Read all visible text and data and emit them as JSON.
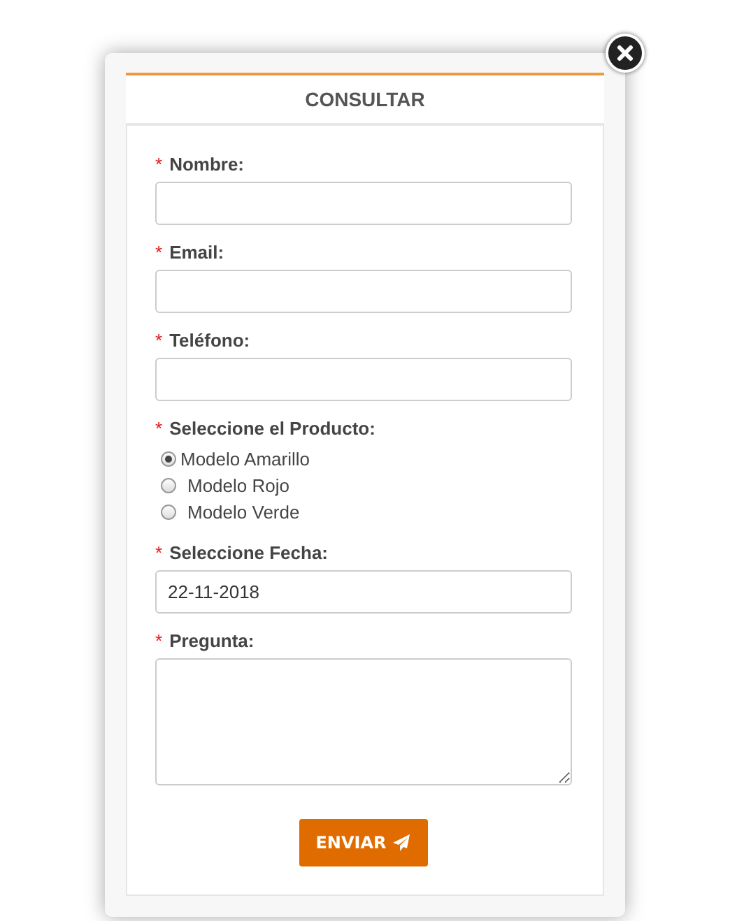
{
  "title": "CONSULTAR",
  "fields": [
    {
      "kind": "text",
      "label": "Nombre:",
      "required_mark": "*"
    },
    {
      "kind": "text",
      "label": "Email:",
      "required_mark": "*"
    },
    {
      "kind": "text",
      "label": "Teléfono:",
      "required_mark": "*"
    },
    {
      "kind": "radio",
      "label": "Seleccione el Producto:",
      "required_mark": "*",
      "options": [
        {
          "label": "Modelo Amarillo",
          "selected": true
        },
        {
          "label": "Modelo Rojo",
          "selected": false
        },
        {
          "label": "Modelo Verde",
          "selected": false
        }
      ]
    },
    {
      "kind": "text",
      "label": "Seleccione Fecha:",
      "required_mark": "*",
      "value": "22-11-2018"
    },
    {
      "kind": "textarea",
      "label": "Pregunta:",
      "required_mark": "*"
    }
  ],
  "submit": {
    "label": "ENVIAR"
  }
}
